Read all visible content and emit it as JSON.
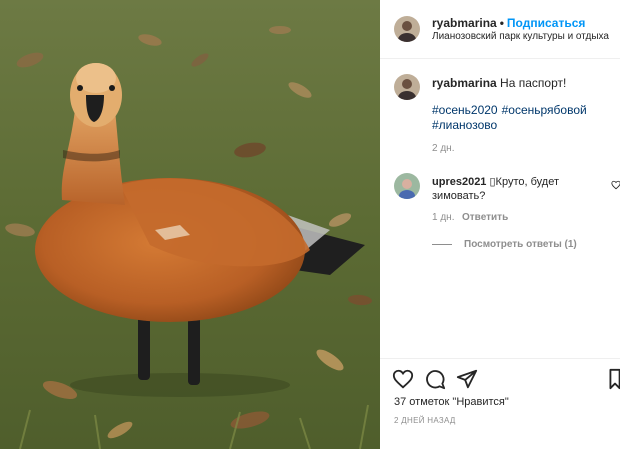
{
  "post": {
    "username": "ryabmarina",
    "separator": "•",
    "follow_label": "Подписаться",
    "location": "Лианозовский парк культуры и отдыха"
  },
  "caption": {
    "username": "ryabmarina",
    "text": "На паспорт!",
    "hashtags": [
      "#осень2020",
      "#осеньрябовой",
      "#лианозово"
    ],
    "time": "2 дн."
  },
  "comment": {
    "username": "upres2021",
    "text": "▯Круто, будет зимовать?",
    "time": "1 дн.",
    "reply_label": "Ответить",
    "view_replies_label": "Посмотреть ответы (1)"
  },
  "actions": {
    "likes_text": "37 отметок \"Нравится\"",
    "posted_ago": "2 ДНЕЙ НАЗАД",
    "icons": [
      "heart-icon",
      "comment-icon",
      "share-icon",
      "bookmark-icon"
    ]
  },
  "colors": {
    "link_blue": "#0095f6",
    "hashtag_blue": "#00376b",
    "secondary_text": "#8e8e8e",
    "duck_orange": "#c0672a"
  }
}
